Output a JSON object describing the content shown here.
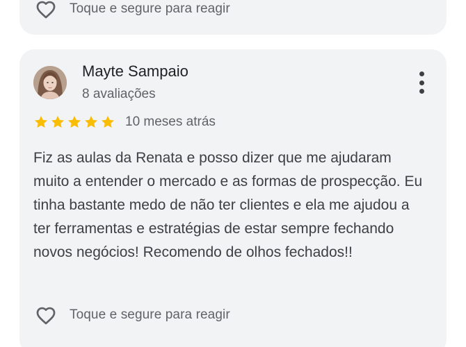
{
  "previous_review": {
    "react_label": "Toque e segure para reagir"
  },
  "review": {
    "author_name": "Mayte Sampaio",
    "author_reviews": "8 avaliações",
    "rating": 5,
    "rating_max": 5,
    "date": "10 meses atrás",
    "text": "Fiz as aulas da Renata e posso dizer que me ajudaram muito a entender o mercado e as formas de prospecção. Eu tinha bastante medo de não ter clientes e ela me ajudou a ter ferramentas e estratégias de estar sempre fechando novos negócios! Recomendo de olhos fechados!!",
    "react_label": "Toque e segure para reagir"
  },
  "icons": {
    "star": "star-icon",
    "heart": "heart-icon",
    "menu": "more-vert-icon"
  },
  "colors": {
    "card_background": "#f1f3f4",
    "star": "#fbbc04",
    "primary_text": "#202124",
    "secondary_text": "#5f6368"
  }
}
